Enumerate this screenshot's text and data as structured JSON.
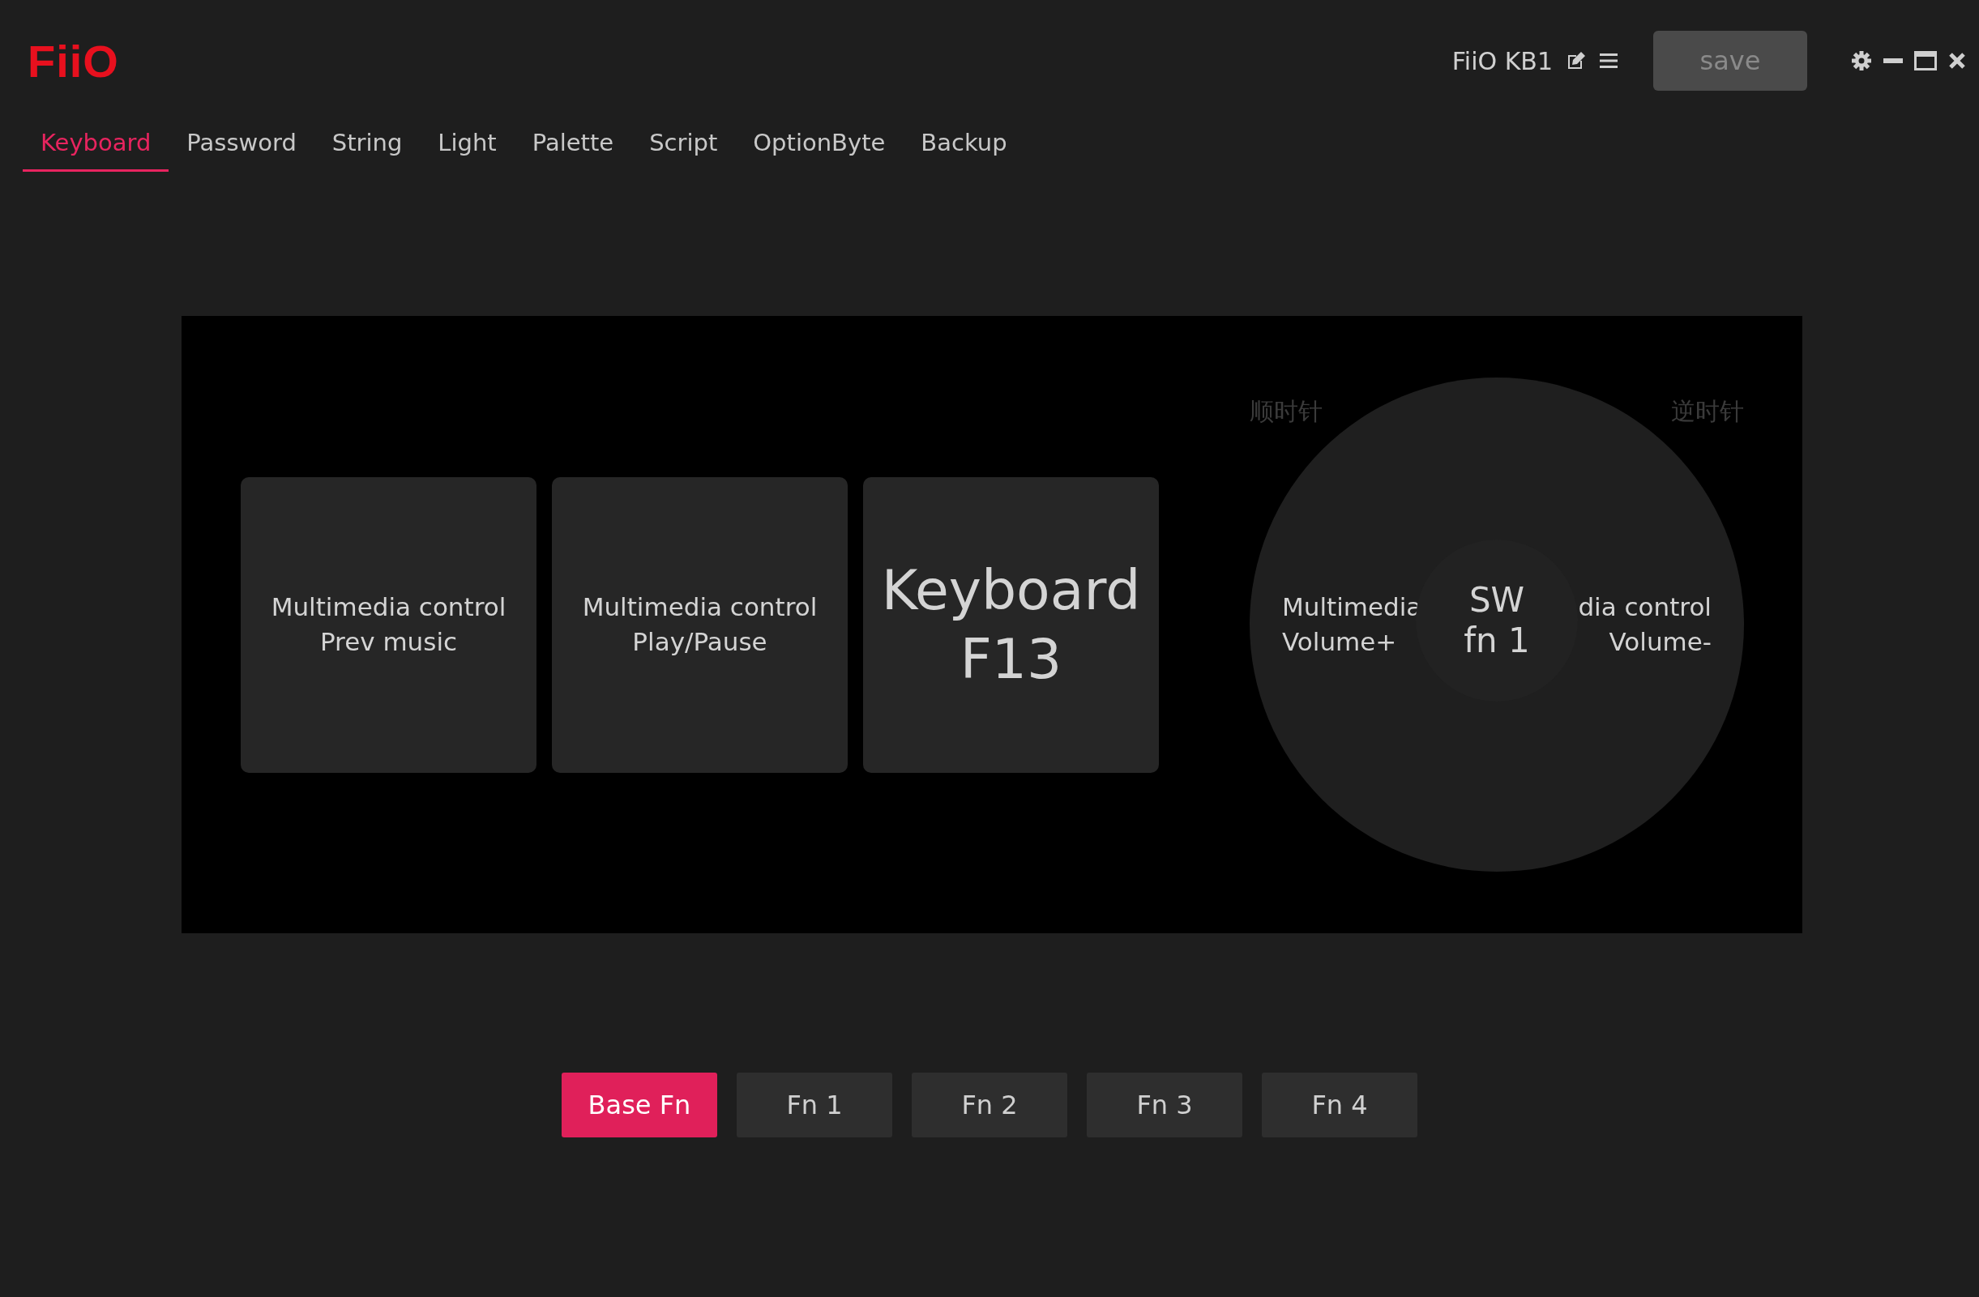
{
  "app": {
    "logo": "FiiO"
  },
  "tabs": [
    {
      "label": "Keyboard",
      "selected": true
    },
    {
      "label": "Password",
      "selected": false
    },
    {
      "label": "String",
      "selected": false
    },
    {
      "label": "Light",
      "selected": false
    },
    {
      "label": "Palette",
      "selected": false
    },
    {
      "label": "Script",
      "selected": false
    },
    {
      "label": "OptionByte",
      "selected": false
    },
    {
      "label": "Backup",
      "selected": false
    }
  ],
  "device": {
    "name": "FiiO KB1"
  },
  "save_button": {
    "label": "save",
    "disabled": true
  },
  "keys": [
    {
      "kind": "normal",
      "lines": [
        "Multimedia control",
        "Prev music"
      ]
    },
    {
      "kind": "normal",
      "lines": [
        "Multimedia control",
        "Play/Pause"
      ]
    },
    {
      "kind": "large",
      "lines": [
        "Keyboard",
        "F13"
      ]
    }
  ],
  "knob": {
    "clockwise_label": "顺时针",
    "counterclockwise_label": "逆时针",
    "left": [
      "Multimedia",
      "Volume+"
    ],
    "right": [
      "dia control",
      "Volume-"
    ],
    "center": [
      "SW",
      "fn 1"
    ]
  },
  "layers": [
    {
      "label": "Base Fn",
      "selected": true
    },
    {
      "label": "Fn 1",
      "selected": false
    },
    {
      "label": "Fn 2",
      "selected": false
    },
    {
      "label": "Fn 3",
      "selected": false
    },
    {
      "label": "Fn 4",
      "selected": false
    }
  ]
}
